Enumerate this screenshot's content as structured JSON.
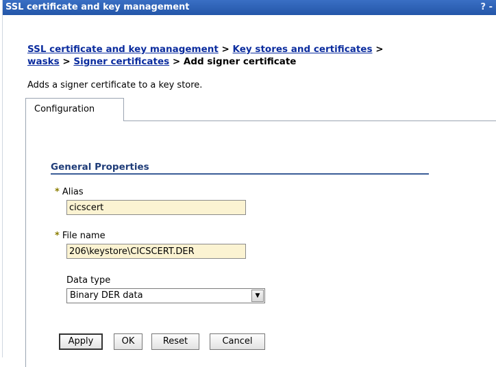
{
  "window": {
    "title": "SSL certificate and key management",
    "help_label": "? -"
  },
  "breadcrumb": {
    "items": [
      "SSL certificate and key management",
      "Key stores and certificates",
      "wasks",
      "Signer certificates"
    ],
    "separator": ">",
    "current": "Add signer certificate"
  },
  "description": "Adds a signer certificate to a key store.",
  "tabs": [
    {
      "label": "Configuration"
    }
  ],
  "section": {
    "title": "General Properties"
  },
  "form": {
    "required_marker": "*",
    "alias": {
      "label": "Alias",
      "value": "cicscert"
    },
    "file_name": {
      "label": "File name",
      "value": "206\\keystore\\CICSCERT.DER"
    },
    "data_type": {
      "label": "Data type",
      "selected": "Binary DER data"
    }
  },
  "buttons": {
    "apply": "Apply",
    "ok": "OK",
    "reset": "Reset",
    "cancel": "Cancel"
  },
  "icons": {
    "dropdown": "chevron-down-icon"
  }
}
